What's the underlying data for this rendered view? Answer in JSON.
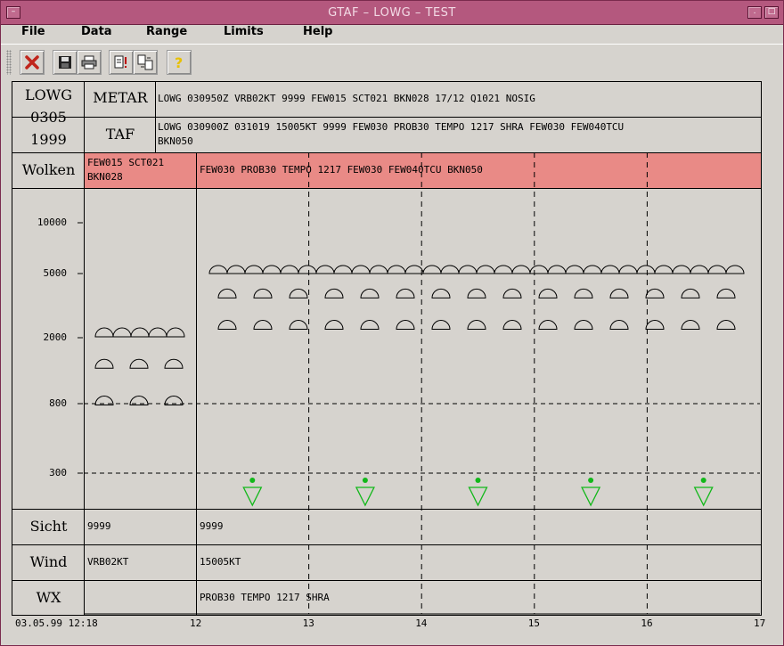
{
  "window": {
    "title": "GTAF – LOWG – TEST"
  },
  "menu": [
    "File",
    "Data",
    "Range",
    "Limits",
    "Help"
  ],
  "toolbar": [
    {
      "name": "close-red-x",
      "glyph": "✘",
      "color": "#c0251c"
    },
    {
      "name": "save-icon",
      "glyph": "▣",
      "color": "#222"
    },
    {
      "name": "print-icon",
      "glyph": "⎙",
      "color": "#222"
    },
    {
      "name": "alert-doc-icon",
      "glyph": "!",
      "color": "#b00"
    },
    {
      "name": "convert-icon",
      "glyph": "⇄",
      "color": "#222"
    },
    {
      "name": "help-icon",
      "glyph": "?",
      "color": "#caa300"
    }
  ],
  "station": {
    "id": "LOWG",
    "day": "0305",
    "year": "1999"
  },
  "rows": {
    "metar_label": "METAR",
    "metar_text": "LOWG 030950Z VRB02KT 9999 FEW015 SCT021 BKN028 17/12 Q1021 NOSIG",
    "taf_label": "TAF",
    "taf_line1": "LOWG 030900Z 031019 15005KT 9999 FEW030 PROB30 TEMPO 1217 SHRA FEW030 FEW040TCU",
    "taf_line2": "BKN050",
    "wolken_label": "Wolken",
    "wolken_metar": "FEW015 SCT021\nBKN028",
    "wolken_taf": "FEW030 PROB30 TEMPO 1217 FEW030 FEW040TCU BKN050",
    "sicht_label": "Sicht",
    "sicht_metar": "9999",
    "sicht_taf": "9999",
    "wind_label": "Wind",
    "wind_metar": "VRB02KT",
    "wind_taf": "15005KT",
    "wx_label": "WX",
    "wx_metar": "",
    "wx_taf": "PROB30 TEMPO 1217 SHRA"
  },
  "chart_data": {
    "type": "scatter",
    "yticks": [
      "10000",
      "5000",
      "2000",
      "800",
      "300"
    ],
    "xticks": [
      "12",
      "13",
      "14",
      "15",
      "16",
      "17"
    ],
    "time_label": "03.05.99 12:18",
    "metar_clouds": [
      {
        "type": "FEW",
        "base_ft": 1500
      },
      {
        "type": "SCT",
        "base_ft": 2100
      },
      {
        "type": "BKN",
        "base_ft": 2800
      }
    ],
    "taf_clouds": [
      {
        "type": "FEW",
        "base_ft": 3000
      },
      {
        "type": "FEW",
        "base_ft": 4000
      },
      {
        "type": "BKN",
        "base_ft": 5000
      }
    ],
    "showers": {
      "label": "SHRA",
      "hours": [
        12.5,
        13.5,
        14.5,
        15.5,
        16.5
      ],
      "color": "#12b81a"
    },
    "colors": {
      "cloud_band": "#e98a86",
      "shower": "#12b81a"
    }
  }
}
